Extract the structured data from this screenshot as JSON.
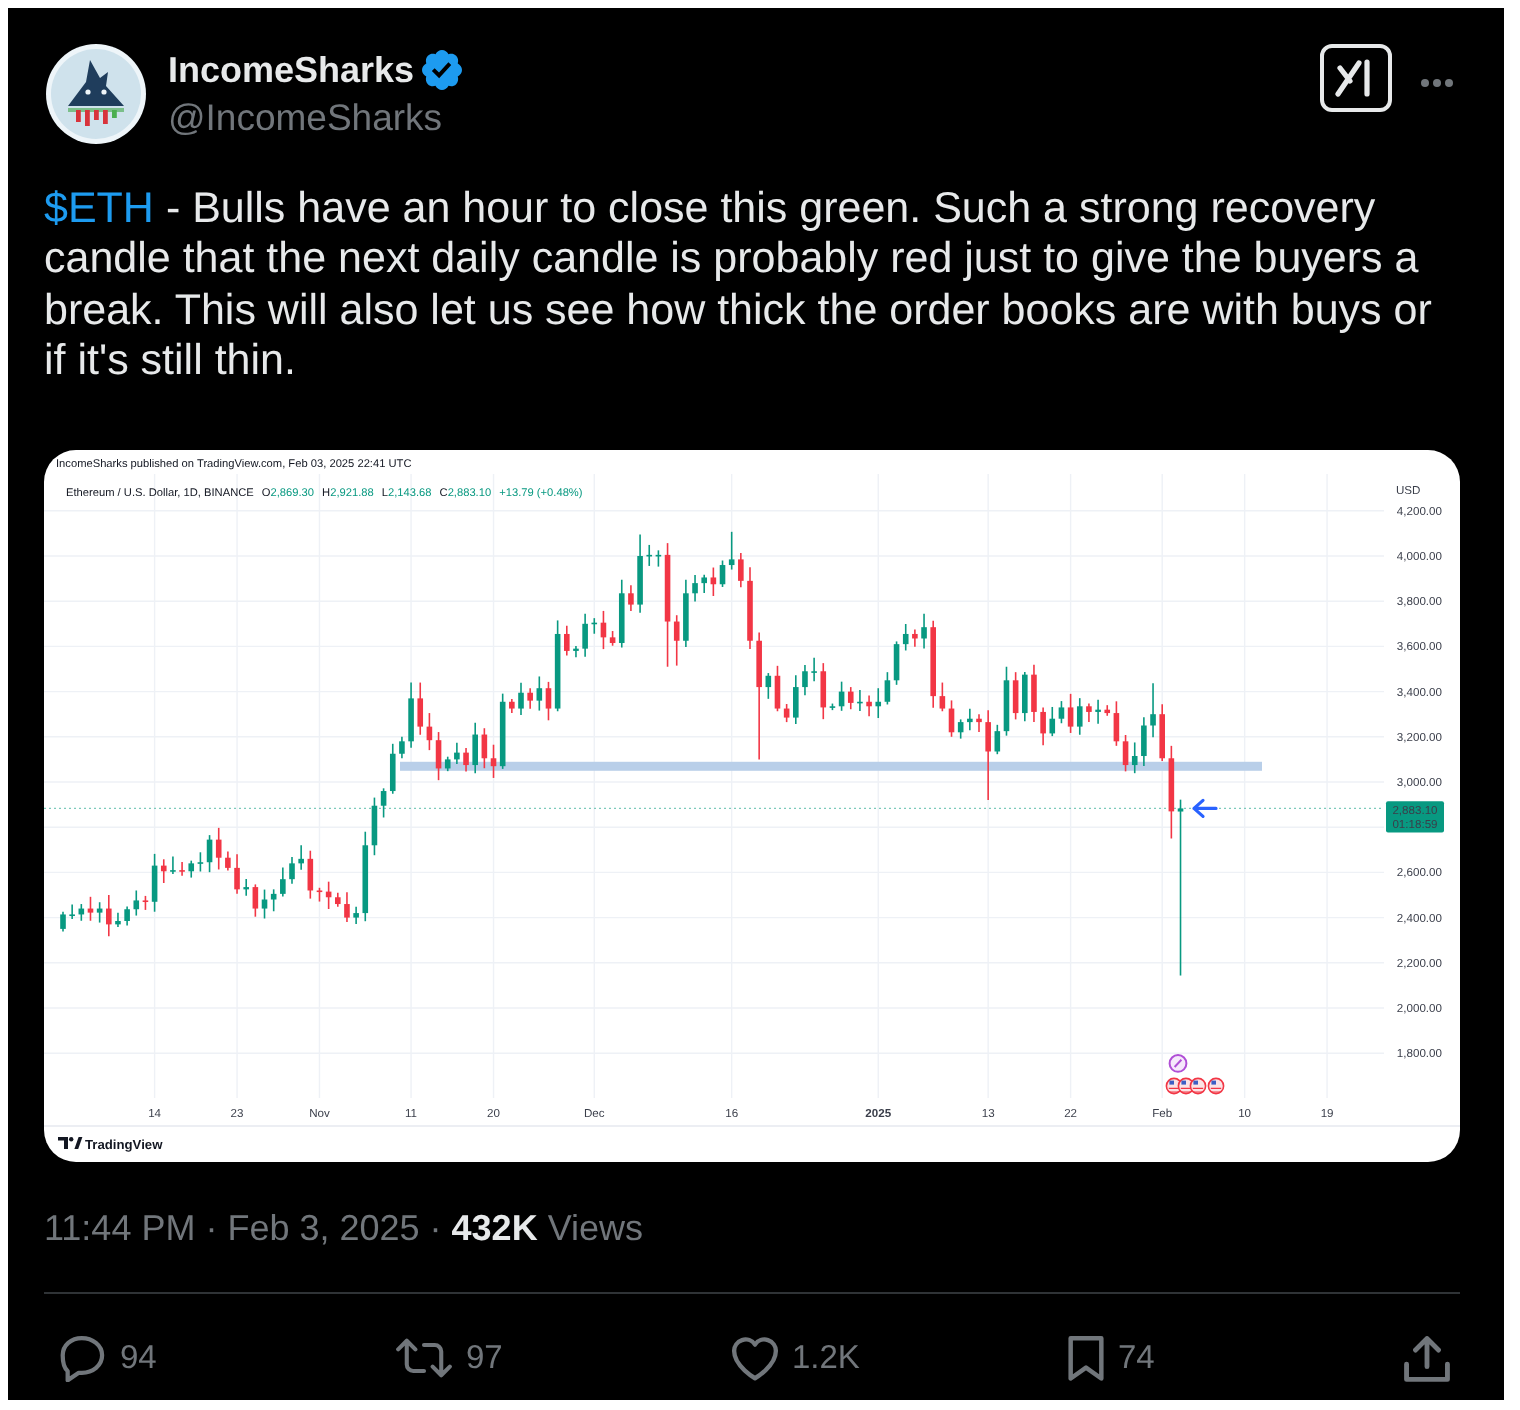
{
  "author": {
    "name": "IncomeSharks",
    "verified": true,
    "handle": "@IncomeSharks"
  },
  "post": {
    "segments": [
      {
        "kind": "cashtag",
        "text": "$ETH"
      },
      {
        "kind": "text",
        "text": " - Bulls have an hour to close this green. Such a strong recovery candle that the next daily candle is probably red just to give the buyers a break. This will also let us see how thick the order books are with buys or if it's still thin."
      }
    ]
  },
  "chart": {
    "publish_note": "IncomeSharks published on TradingView.com, Feb 03, 2025 22:41 UTC",
    "symbol": "Ethereum / U.S. Dollar, 1D, BINANCE",
    "ohlc": [
      {
        "label": "O",
        "value": "2,869.30"
      },
      {
        "label": "H",
        "value": "2,921.88"
      },
      {
        "label": "L",
        "value": "2,143.68"
      },
      {
        "label": "C",
        "value": "2,883.10"
      }
    ],
    "change": "+13.79 (+0.48%)",
    "currency": "USD",
    "y_labels": [
      "4,200.00",
      "4,000.00",
      "3,800.00",
      "3,600.00",
      "3,400.00",
      "3,200.00",
      "3,000.00",
      "2,600.00",
      "2,400.00",
      "2,200.00",
      "2,000.00",
      "1,800.00"
    ],
    "price_tag": {
      "price": "2,883.10",
      "countdown": "01:18:59"
    },
    "x_labels": [
      {
        "text": "14",
        "kind": "date"
      },
      {
        "text": "23",
        "kind": "date"
      },
      {
        "text": "Nov",
        "kind": "date"
      },
      {
        "text": "11",
        "kind": "date"
      },
      {
        "text": "20",
        "kind": "date"
      },
      {
        "text": "Dec",
        "kind": "date"
      },
      {
        "text": "16",
        "kind": "date"
      },
      {
        "text": "2025",
        "kind": "year"
      },
      {
        "text": "13",
        "kind": "date"
      },
      {
        "text": "22",
        "kind": "date"
      },
      {
        "text": "Feb",
        "kind": "date"
      },
      {
        "text": "10",
        "kind": "date"
      },
      {
        "text": "19",
        "kind": "date"
      }
    ],
    "brand": "TradingView"
  },
  "meta": "11:44 PM · Feb 3, 2025 · **432K** Views",
  "actions": [
    {
      "kind": "reply",
      "count": "94"
    },
    {
      "kind": "repost",
      "count": "97"
    },
    {
      "kind": "like",
      "count": "1.2K"
    },
    {
      "kind": "bookmark",
      "count": "74"
    },
    {
      "kind": "share"
    }
  ]
}
